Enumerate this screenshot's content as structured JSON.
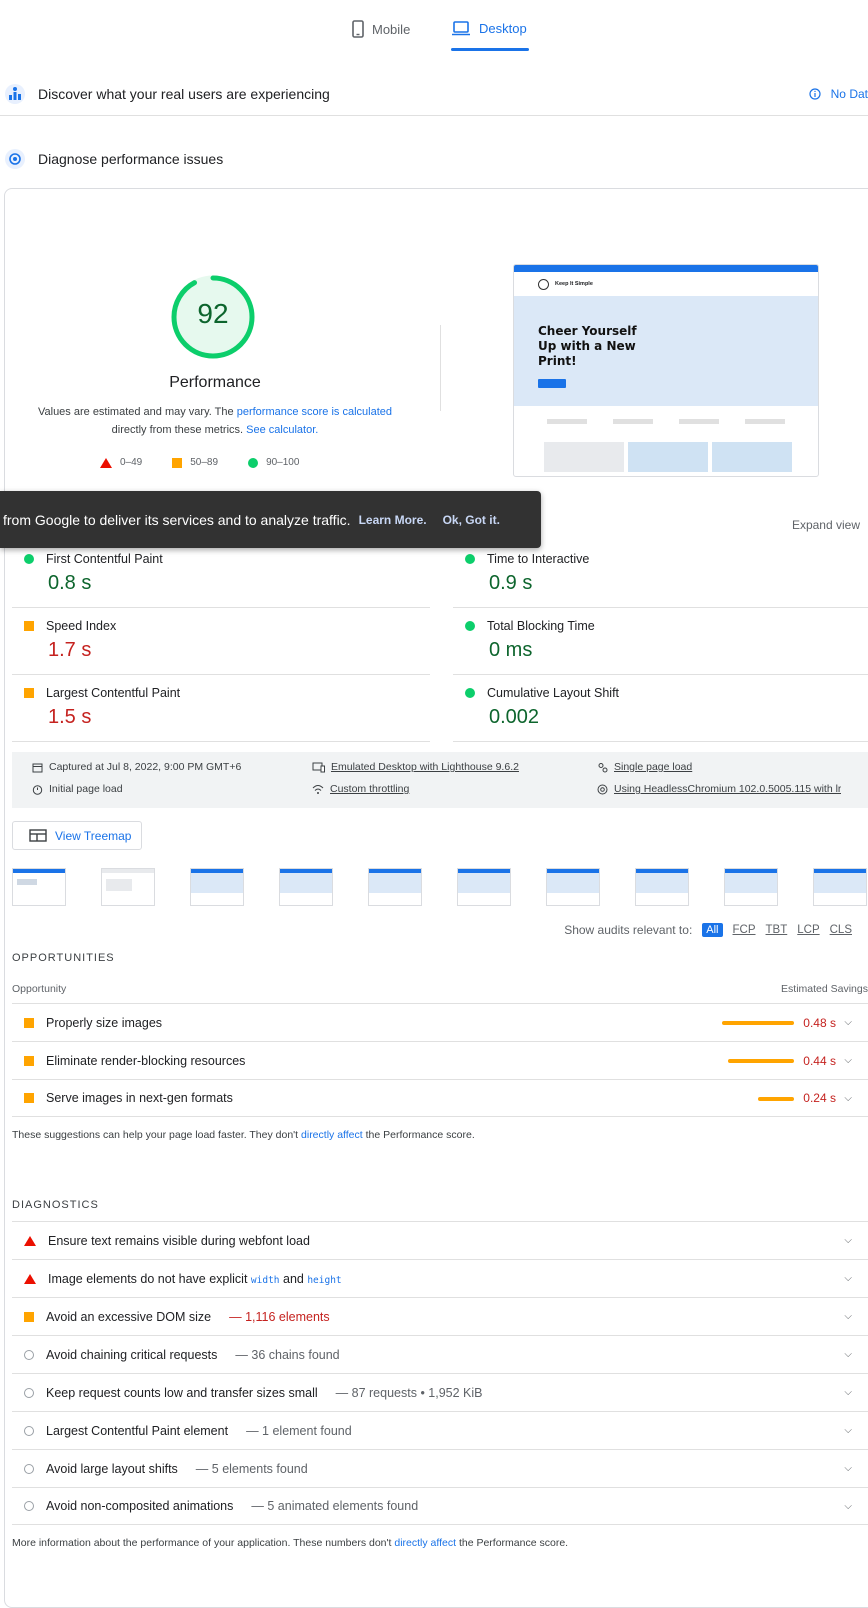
{
  "tabs": {
    "mobile": "Mobile",
    "desktop": "Desktop"
  },
  "field_data": {
    "title": "Discover what your real users are experiencing",
    "no_data": "No Dat"
  },
  "diagnose": {
    "title": "Diagnose performance issues"
  },
  "score": {
    "value": "92",
    "score_fraction": 0.92,
    "label": "Performance",
    "note_a": "Values are estimated and may vary. The ",
    "note_link1": "performance score is calculated",
    "note_b": "directly from these metrics. ",
    "note_link2": "See calculator.",
    "legend": {
      "fail": "0–49",
      "average": "50–89",
      "pass": "90–100"
    },
    "color_pass": "#0cce6b",
    "color_average": "#ffa400",
    "color_fail": "#eb0f00"
  },
  "preview": {
    "brand": "Keep It Simple",
    "headline_1": "Cheer Yourself",
    "headline_2": "Up with a New",
    "headline_3": "Print!"
  },
  "toast": {
    "text": "from Google to deliver its services and to analyze traffic.",
    "learn_more": "Learn More.",
    "ok": "Ok, Got it."
  },
  "metrics_header": {
    "expand": "Expand view"
  },
  "metrics": [
    {
      "label": "First Contentful Paint",
      "value": "0.8 s",
      "status": "pass"
    },
    {
      "label": "Time to Interactive",
      "value": "0.9 s",
      "status": "pass"
    },
    {
      "label": "Speed Index",
      "value": "1.7 s",
      "status": "average"
    },
    {
      "label": "Total Blocking Time",
      "value": "0 ms",
      "status": "pass"
    },
    {
      "label": "Largest Contentful Paint",
      "value": "1.5 s",
      "status": "average"
    },
    {
      "label": "Cumulative Layout Shift",
      "value": "0.002",
      "status": "pass"
    }
  ],
  "run_info": {
    "captured": "Captured at Jul 8, 2022, 9:00 PM GMT+6",
    "initial": "Initial page load",
    "emulated": "Emulated Desktop with Lighthouse 9.6.2",
    "throttling": "Custom throttling",
    "single": "Single page load",
    "browser": "Using HeadlessChromium 102.0.5005.115 with lr"
  },
  "treemap": {
    "label": "View Treemap"
  },
  "audit_filter": {
    "label": "Show audits relevant to:",
    "all": "All",
    "fcp": "FCP",
    "tbt": "TBT",
    "lcp": "LCP",
    "cls": "CLS"
  },
  "opportunities": {
    "title": "OPPORTUNITIES",
    "col_left": "Opportunity",
    "col_right": "Estimated Savings",
    "items": [
      {
        "label": "Properly size images",
        "savings": "0.48 s",
        "fraction": 1.0
      },
      {
        "label": "Eliminate render-blocking resources",
        "savings": "0.44 s",
        "fraction": 0.92
      },
      {
        "label": "Serve images in next-gen formats",
        "savings": "0.24 s",
        "fraction": 0.5
      }
    ],
    "note_a": "These suggestions can help your page load faster. They don't ",
    "note_link": "directly affect",
    "note_b": " the Performance score."
  },
  "diagnostics": {
    "title": "DIAGNOSTICS",
    "items": [
      {
        "label": "Ensure text remains visible during webfont load",
        "extra": "",
        "status": "fail"
      },
      {
        "label": "Image elements do not have explicit ",
        "code1": "width",
        "and": " and ",
        "code2": "height",
        "extra": "",
        "status": "fail"
      },
      {
        "label": "Avoid an excessive DOM size",
        "extra": "— 1,116 elements",
        "status": "average"
      },
      {
        "label": "Avoid chaining critical requests",
        "extra": "— 36 chains found",
        "status": "info"
      },
      {
        "label": "Keep request counts low and transfer sizes small",
        "extra": "— 87 requests • 1,952 KiB",
        "status": "info"
      },
      {
        "label": "Largest Contentful Paint element",
        "extra": "— 1 element found",
        "status": "info"
      },
      {
        "label": "Avoid large layout shifts",
        "extra": "— 5 elements found",
        "status": "info"
      },
      {
        "label": "Avoid non-composited animations",
        "extra": "— 5 animated elements found",
        "status": "info"
      }
    ],
    "note_a": "More information about the performance of your application. These numbers don't ",
    "note_link": "directly affect",
    "note_b": " the Performance score."
  }
}
